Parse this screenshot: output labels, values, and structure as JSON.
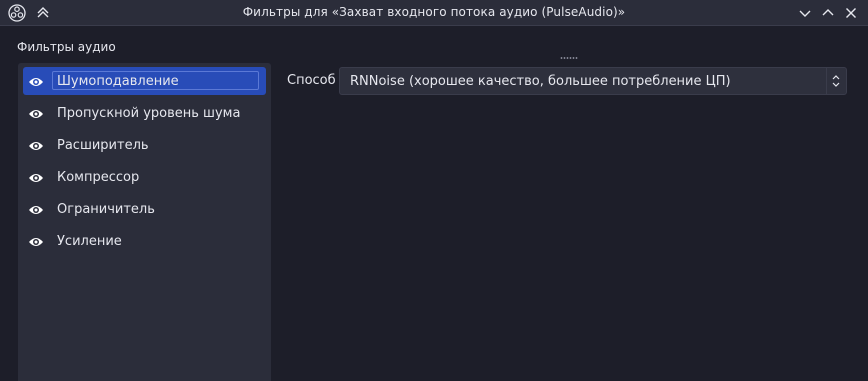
{
  "window": {
    "title": "Фильтры для «Захват входного потока аудио (PulseAudio)»",
    "icons": {
      "logo": "obs-logo-icon",
      "keep_above": "keep-above-icon",
      "minimize": "minimize-icon",
      "maximize": "maximize-icon",
      "close": "close-icon"
    }
  },
  "filters_panel": {
    "title": "Фильтры аудио",
    "items": [
      {
        "label": "Шумоподавление",
        "selected": true,
        "icon": "eye-icon"
      },
      {
        "label": "Пропускной уровень шума",
        "selected": false,
        "icon": "eye-icon"
      },
      {
        "label": "Расширитель",
        "selected": false,
        "icon": "eye-icon"
      },
      {
        "label": "Компрессор",
        "selected": false,
        "icon": "eye-icon"
      },
      {
        "label": "Ограничитель",
        "selected": false,
        "icon": "eye-icon"
      },
      {
        "label": "Усиление",
        "selected": false,
        "icon": "eye-icon"
      }
    ]
  },
  "properties": {
    "method_label": "Способ",
    "method_value": "RNNoise (хорошее качество, большее потребление ЦП)"
  },
  "colors": {
    "background": "#1d1e29",
    "panel": "#2b2d3a",
    "selection": "#284cb8",
    "text": "#e6e7ee"
  }
}
